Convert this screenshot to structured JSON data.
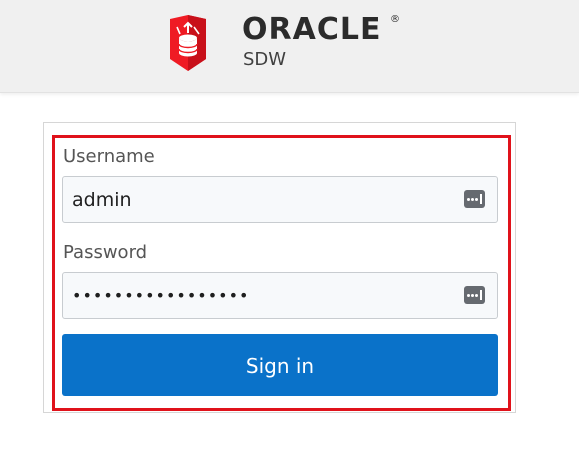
{
  "header": {
    "brand": "ORACLE",
    "registered_mark": "®",
    "product": "SDW",
    "logo_icon": "shield-database-icon",
    "logo_color": "#ef1b24"
  },
  "form": {
    "username_label": "Username",
    "username_value": "admin",
    "password_label": "Password",
    "password_value": "•••••••••••••••••",
    "field_icon": "password-manager-key-icon",
    "signin_label": "Sign in",
    "signin_color": "#0a72c9",
    "highlight_color": "#e0121b"
  }
}
